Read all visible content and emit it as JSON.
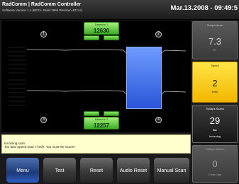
{
  "titlebar": {
    "title": "RadComm | RadComm Controller",
    "subtitle": "Software Version 1.1 [BETA: Build 2665 Revision 4074+]",
    "datetime": "Mar.13.2008 - 09:49:5"
  },
  "graph": {
    "detector_top": {
      "label": "Detector 1",
      "value": "12630"
    },
    "detector_bottom": {
      "label": "Detector 2",
      "value": "12257"
    },
    "markers": [
      "1",
      "2",
      "3",
      "4"
    ]
  },
  "side": {
    "temperature": {
      "label": "Temperature",
      "value": "7.3",
      "unit": "C°"
    },
    "speed": {
      "label": "Speed",
      "value": "2",
      "unit": "km/h"
    },
    "scans": {
      "label": "Today's Scans",
      "value": "29",
      "icon": "arrow-left-icon",
      "unit": "Incoming"
    },
    "alarms": {
      "label": "Today's Alarms",
      "value": "0",
      "unit": "Clean day"
    }
  },
  "message": {
    "line1": "Incoming scan",
    "line2": "Too fast! Speed read 7 km/h. You must Re-Scan!!!"
  },
  "buttons": {
    "menu": "Menu",
    "test": "Test",
    "reset": "Reset",
    "audio_reset": "Audio Reset",
    "manual_scan": "Manual Scan"
  },
  "colors": {
    "speed_highlight": "#f2b600",
    "detector_green": "#3cae22",
    "scan_blue": "#2a55d8",
    "message_bg": "#fffecd"
  }
}
